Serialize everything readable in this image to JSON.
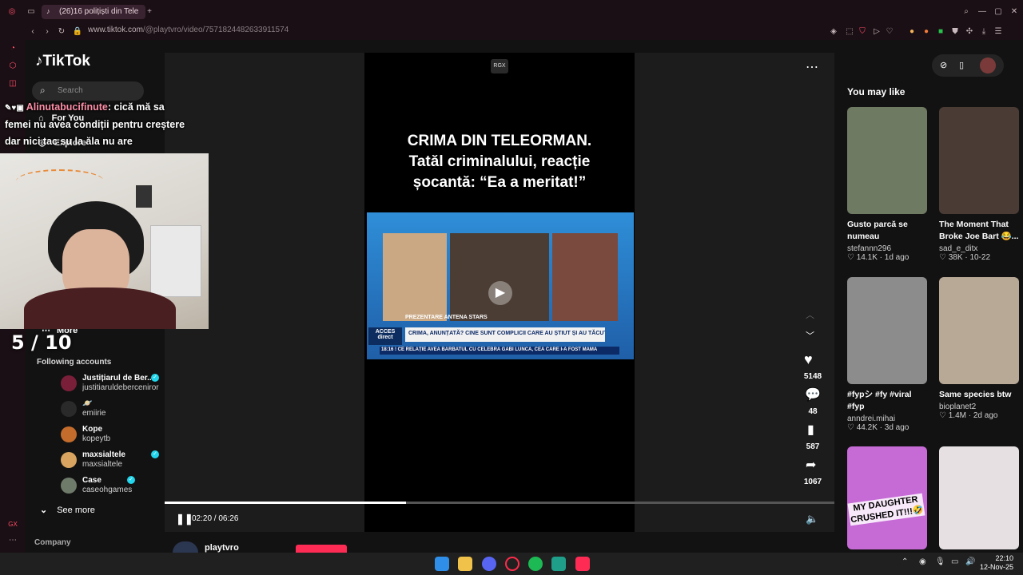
{
  "browser": {
    "tab_title": "(26)16 polițiști din Tele",
    "url_domain": "www.tiktok.com",
    "url_path": "/@playtvro/video/7571824482633911574"
  },
  "tiktok": {
    "logo": "TikTok",
    "search_placeholder": "Search",
    "nav": {
      "for_you": "For You",
      "explore": "Explore",
      "more": "More"
    },
    "following_header": "Following accounts",
    "following": [
      {
        "name": "Justițiarul de Ber...",
        "handle": "justitiaruldeberceniror",
        "verified": true
      },
      {
        "name": "🪐",
        "handle": "emiirie",
        "verified": false
      },
      {
        "name": "Kope",
        "handle": "kopeytb",
        "verified": false
      },
      {
        "name": "maxsialtele",
        "handle": "maxsialtele",
        "verified": true
      },
      {
        "name": "Case",
        "handle": "caseohgames",
        "verified": true
      }
    ],
    "see_more": "See more",
    "company": "Company"
  },
  "overlay": {
    "chat_user": "Alinutabucifinute",
    "chat_text_1": ": cică mă sa",
    "chat_text_2": "femei nu avea condiții pentru creștere",
    "chat_text_3": "dar nici tac su la ăla nu are",
    "counter": "5 / 10"
  },
  "video": {
    "watermark": "RGX",
    "headline_1": "CRIMA DIN TELEORMAN.",
    "headline_2": "Tatăl criminalului, reacție",
    "headline_3": "șocantă: “Ea a meritat!”",
    "clip_banner": "CRIMA, ANUNȚATĂ? CINE SUNT COMPLICII CARE AU ȘTIUT ȘI AU TĂCUT?",
    "clip_ticker": "18:16 ! CE RELAȚIE AVEA BĂRBATUL CU CELEBRA GABI LUNCA, CEA CARE I-A FOST MAMA",
    "clip_channel": "ACCES direct",
    "clip_label": "PREZENTARE ANTENA STARS",
    "likes": "5148",
    "comments": "48",
    "saves": "587",
    "shares": "1067",
    "time": "02:20 / 06:26",
    "progress": 0.36,
    "author": "playtvro"
  },
  "recommendations": {
    "header": "You may like",
    "items": [
      {
        "title": "Gusto parcă se numeau",
        "author": "stefannn296",
        "likes": "14.1K",
        "age": "1d ago",
        "color": "#6f7a62"
      },
      {
        "title": "The Moment That Broke Joe Bart 😂...",
        "author": "sad_e_ditx",
        "likes": "38K",
        "age": "10-22",
        "color": "#4a3b35"
      },
      {
        "title": "#fypシ #fy #viral #fyp",
        "author": "anndrei.mihai",
        "likes": "44.2K",
        "age": "3d ago",
        "color": "#8c8c8c"
      },
      {
        "title": "Same species btw",
        "author": "bioplanet2",
        "likes": "1.4M",
        "age": "2d ago",
        "color": "#b8a896"
      },
      {
        "title": "",
        "author": "",
        "likes": "",
        "age": "",
        "color": "#c66ad6"
      },
      {
        "title": "",
        "author": "",
        "likes": "",
        "age": "",
        "color": "#e6e0e2"
      }
    ],
    "thumb_text_1": "MY DAUGHTER CRUSHED IT!!!🤣"
  },
  "taskbar": {
    "time": "22:10",
    "date": "12-Nov-25"
  }
}
